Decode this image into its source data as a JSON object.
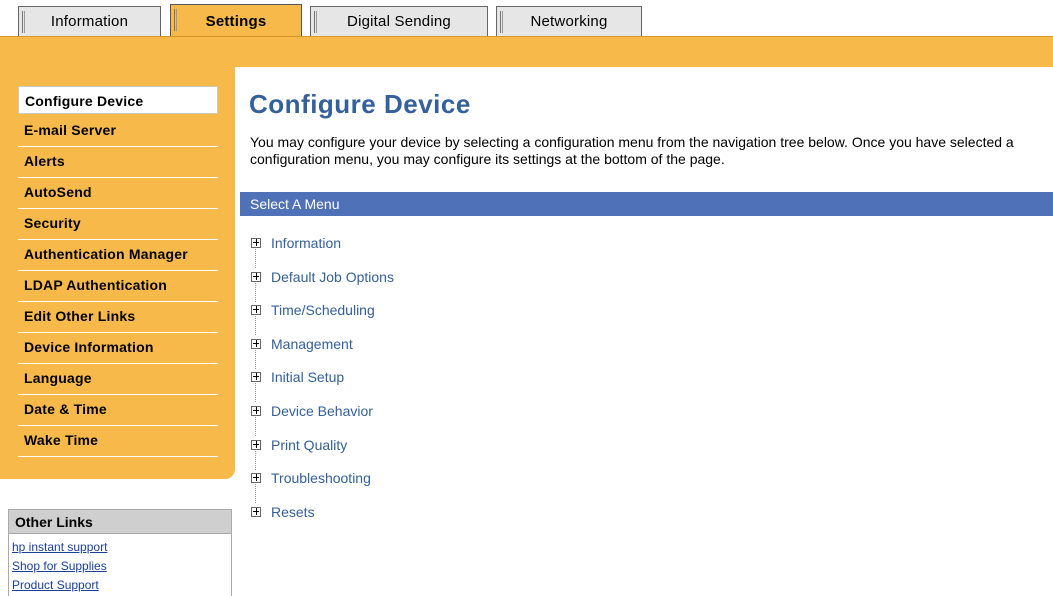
{
  "tabs": [
    {
      "label": "Information",
      "active": false
    },
    {
      "label": "Settings",
      "active": true
    },
    {
      "label": "Digital Sending",
      "active": false
    },
    {
      "label": "Networking",
      "active": false
    }
  ],
  "sidebar": {
    "items": [
      {
        "label": "Configure Device",
        "selected": true
      },
      {
        "label": "E-mail Server"
      },
      {
        "label": "Alerts"
      },
      {
        "label": "AutoSend"
      },
      {
        "label": "Security"
      },
      {
        "label": "Authentication Manager"
      },
      {
        "label": "LDAP Authentication"
      },
      {
        "label": "Edit Other Links"
      },
      {
        "label": "Device Information"
      },
      {
        "label": "Language"
      },
      {
        "label": "Date & Time"
      },
      {
        "label": "Wake Time"
      }
    ]
  },
  "other_links": {
    "title": "Other Links",
    "links": [
      "hp instant support",
      "Shop for Supplies",
      "Product Support"
    ]
  },
  "main": {
    "title": "Configure Device",
    "description": "You may configure your device by selecting a configuration menu from the navigation tree below. Once you have selected a configuration menu, you may configure its settings at the bottom of the page.",
    "menu_header": "Select A Menu",
    "tree": [
      "Information",
      "Default Job Options",
      "Time/Scheduling",
      "Management",
      "Initial Setup",
      "Device Behavior",
      "Print Quality",
      "Troubleshooting",
      "Resets"
    ]
  },
  "colors": {
    "accent_orange": "#f6b94a",
    "menu_blue": "#4f71b8",
    "title_blue": "#34609c"
  }
}
